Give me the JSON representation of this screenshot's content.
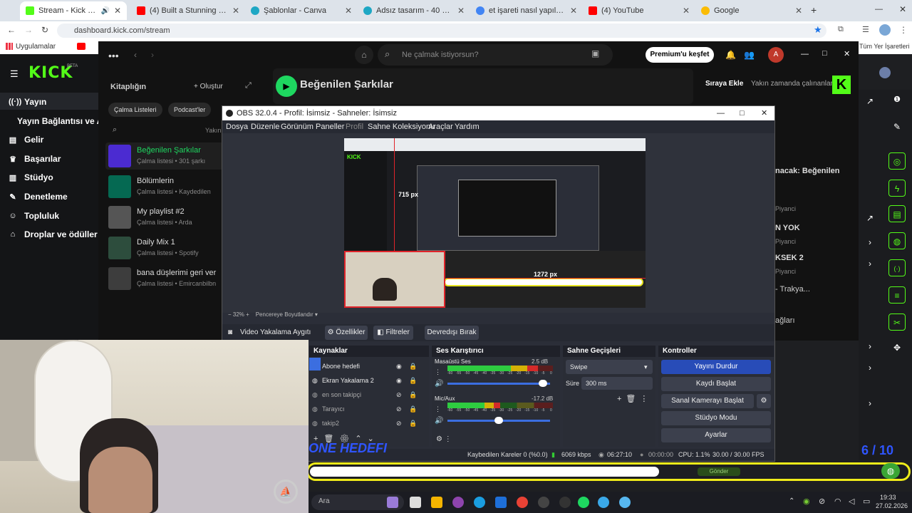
{
  "browser": {
    "tabs": [
      {
        "label": "Stream - Kick Dashboard",
        "active": true
      },
      {
        "label": "(4) Built a Stunning 3-Story Ho"
      },
      {
        "label": "Şablonlar - Canva"
      },
      {
        "label": "Adsız tasarım - 40 × 40 px"
      },
      {
        "label": "et işareti nasıl yapılır - Google'd"
      },
      {
        "label": "(4) YouTube"
      },
      {
        "label": "Google"
      }
    ],
    "url": "dashboard.kick.com/stream",
    "bookmarks": {
      "apps": "Uygulamalar",
      "all": "Tüm Yer İşaretleri"
    }
  },
  "kick": {
    "logo": "KICK",
    "beta": "BETA",
    "nav": [
      {
        "icon": "broadcast-icon",
        "label": "Yayın"
      },
      {
        "icon": "",
        "label": "Yayın Bağlantısı ve An"
      },
      {
        "icon": "money-icon",
        "label": "Gelir"
      },
      {
        "icon": "trophy-icon",
        "label": "Başarılar"
      },
      {
        "icon": "studio-icon",
        "label": "Stüdyo"
      },
      {
        "icon": "wrench-icon",
        "label": "Denetleme"
      },
      {
        "icon": "people-icon",
        "label": "Topluluk"
      },
      {
        "icon": "gift-icon",
        "label": "Droplar ve ödüller"
      }
    ]
  },
  "spotify": {
    "search_placeholder": "Ne çalmak istiyorsun?",
    "premium_button": "Premium'u keşfet",
    "avatar_letter": "A",
    "library_title": "Kitaplığın",
    "create": "Oluştur",
    "filters": [
      "Çalma Listeleri",
      "Podcast'ler"
    ],
    "sort_label": "Yakın",
    "playlist_title": "Beğenilen Şarkılar",
    "queue_tabs": [
      "Sıraya Ekle",
      "Yakın zamanda çalınanlar"
    ],
    "library_items": [
      {
        "title": "Beğenilen Şarkılar",
        "subtitle": "Çalma listesi • 301 şarkı",
        "color": "#4b2bd1"
      },
      {
        "title": "Bölümlerin",
        "subtitle": "Çalma listesi • Kaydedilen",
        "color": "#056952"
      },
      {
        "title": "My playlist #2",
        "subtitle": "Çalma listesi • Arda",
        "color": "#555555"
      },
      {
        "title": "Daily Mix 1",
        "subtitle": "Çalma listesi • Spotify",
        "color": "#2d4d3d"
      },
      {
        "title": "bana düşlerimi geri ver",
        "subtitle": "Çalma listesi • Emircanbilbn",
        "color": "#3d3d3d"
      }
    ],
    "right_panel": [
      "nacak: Beğenilen",
      "Piyanci",
      "N YOK",
      "Piyanci",
      "KSEK 2",
      "Piyanci",
      "- Trakya...",
      "ağları"
    ]
  },
  "obs": {
    "title": "OBS 32.0.4 - Profil: İsimsiz - Sahneler: İsimsiz",
    "menu": [
      "Dosya",
      "Düzenle",
      "Görünüm",
      "Paneller",
      "Profil",
      "Sahne Koleksiyonu",
      "Araçlar",
      "Yardım"
    ],
    "preview": {
      "zoom": "32%",
      "fit": "Pencereye Boyutlandır",
      "px_top": "715 px",
      "px_right": "1272 px"
    },
    "source_bar": {
      "name": "Video Yakalama Aygıtı",
      "properties": "Özellikler",
      "filters": "Filtreler",
      "deactivate": "Devredışı Bırak"
    },
    "sources": {
      "title": "Kaynaklar",
      "items": [
        "Abone hedefi",
        "Ekran Yakalama 2",
        "en son takipçi",
        "Tarayıcı",
        "takip2"
      ]
    },
    "mixer": {
      "title": "Ses Karıştırıcı",
      "channels": [
        {
          "name": "Masaüstü Ses",
          "db": "2.5 dB",
          "level": 0.86
        },
        {
          "name": "Mic/Aux",
          "db": "-17.2 dB",
          "level": 0.5
        }
      ],
      "scale": [
        "-60",
        "-55",
        "-50",
        "-45",
        "-40",
        "-35",
        "-30",
        "-25",
        "-20",
        "-15",
        "-10",
        "-5",
        "0"
      ]
    },
    "transitions": {
      "title": "Sahne Geçişleri",
      "type": "Swipe",
      "duration_label": "Süre",
      "duration": "300 ms"
    },
    "controls": {
      "title": "Kontroller",
      "stop_stream": "Yayını Durdur",
      "record": "Kaydı Başlat",
      "virtual_cam": "Sanal Kamerayı Başlat",
      "studio_mode": "Stüdyo Modu",
      "settings": "Ayarlar"
    },
    "status": {
      "dropped": "Kaybedilen Kareler 0 (%0.0)",
      "bitrate": "6069 kbps",
      "live": "06:27:10",
      "rec": "00:00:00",
      "cpu": "CPU: 1.1%",
      "fps": "30.00 / 30.00 FPS"
    }
  },
  "overlay": {
    "goal_text": "ONE HEDEFI",
    "counter": "6 / 10",
    "button": "Gönder"
  },
  "taskbar": {
    "search": "Ara",
    "time": "19:33",
    "date": "27.02.2026"
  }
}
